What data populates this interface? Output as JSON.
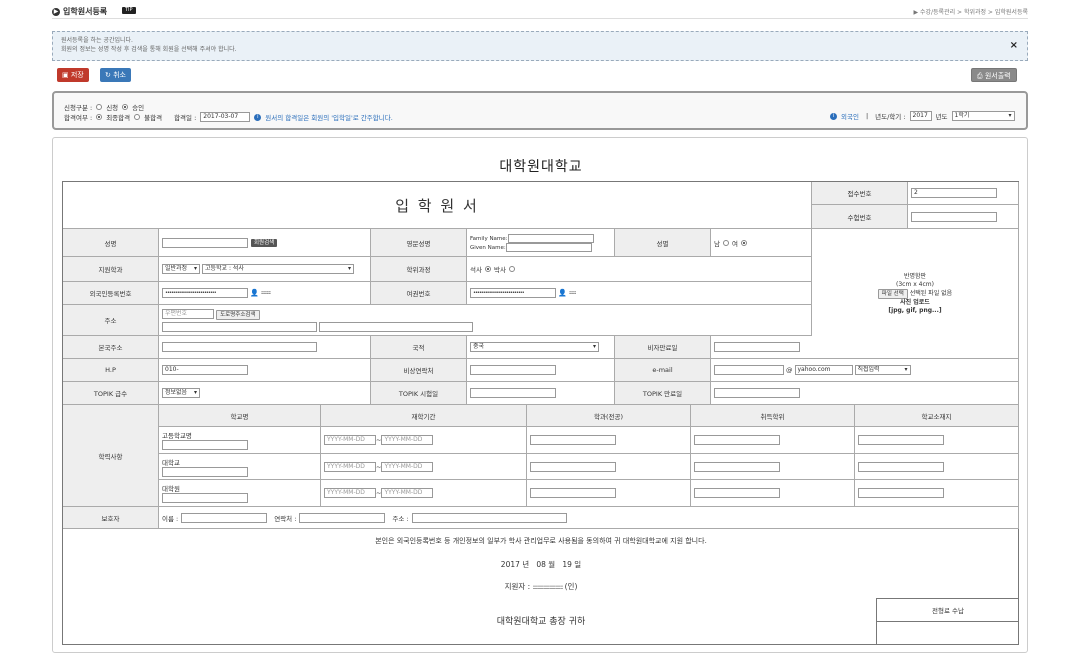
{
  "header": {
    "title": "입학원서등록",
    "tip": "TIP",
    "breadcrumb": "▶ 수강/등록관리 > 학위과정 > 입학원서등록"
  },
  "info": {
    "line1": "원서등록을 하는 공간입니다.",
    "line2": "회원의 정보는 성명 작성 후 검색을 통해 회원을 선택해 주셔야 합니다.",
    "close": "×"
  },
  "toolbar": {
    "save": "저장",
    "cancel": "취소",
    "print": "원서출력"
  },
  "cond": {
    "apply_label": "신청구분 :",
    "apply_opt1": "신청",
    "apply_opt2": "승인",
    "pass_label": "합격여부 :",
    "pass_opt1": "최종합격",
    "pass_opt2": "불합격",
    "pass_date_label": "합격일 :",
    "pass_date": "2017-03-07",
    "pass_note": "원서의 합격일은 회원의 '입학일'로 간주합니다.",
    "foreigner": "외국인",
    "year_label": "년도/학기 :",
    "year": "2017",
    "year_suffix": "년도",
    "semester": "1학기"
  },
  "form": {
    "school": "대학원대학교",
    "title": "입 학 원 서",
    "receipt_no": "접수번호",
    "receipt_val": "2",
    "exam_no": "수험번호",
    "name": "성명",
    "member_search": "회원검색",
    "eng_name": "영문성명",
    "family_name": "Family Name:",
    "given_name": "Given Name:",
    "gender": "성별",
    "male": "남",
    "female": "여",
    "dept": "지원학과",
    "dept_val1": "일반과정",
    "dept_val2": "고등학교 : 석사",
    "degree": "학위과정",
    "master": "석사",
    "doctor": "박사",
    "photo1": "반명함판",
    "photo2": "(3cm x 4cm)",
    "photo_btn": "파일 선택",
    "photo_none": "선택된 파일 없음",
    "photo_upload": "사진 업로드",
    "photo_ext": "[jpg, gif, png...]",
    "alien_no": "외국인등록번호",
    "passport_no": "여권번호",
    "address": "주소",
    "zip_ph": "우편번호",
    "road_search": "도로명주소검색",
    "home_address": "본국주소",
    "nationality": "국적",
    "nationality_val": "중국",
    "visa_expiry": "비자만료일",
    "hp": "H.P",
    "hp_val": "010-",
    "emergency": "비상연락처",
    "email": "e-mail",
    "email_at": "@",
    "email_domain": "yahoo.com",
    "email_direct": "직접입력",
    "topik_level": "TOPIK 급수",
    "topik_level_val": "정보없음",
    "topik_date": "TOPIK 시험일",
    "topik_expiry": "TOPIK 만료일",
    "academic": "학력사항",
    "col_school": "학교명",
    "col_period": "재학기간",
    "col_major": "학과(전공)",
    "col_degree": "취득학위",
    "col_location": "학교소재지",
    "row1": "고등학교명",
    "row2": "대학교",
    "row3": "대학원",
    "date_ph": "YYYY-MM-DD",
    "guardian": "보호자",
    "g_name": "이름 :",
    "g_contact": "연락처 :",
    "g_address": "주소 :",
    "consent": "본인은 외국인등록번호 등 개인정보의 일부가 학사 관리업무로 사용됨을 동의하여 귀 대학원대학교에 지원 합니다.",
    "date_year": "2017",
    "date_year_label": "년",
    "date_month": "08",
    "date_month_label": "월",
    "date_day": "19",
    "date_day_label": "일",
    "applicant": "지원자 :",
    "seal": "(인)",
    "president": "대학원대학교 총장 귀하",
    "fee": "전형료 수납"
  }
}
